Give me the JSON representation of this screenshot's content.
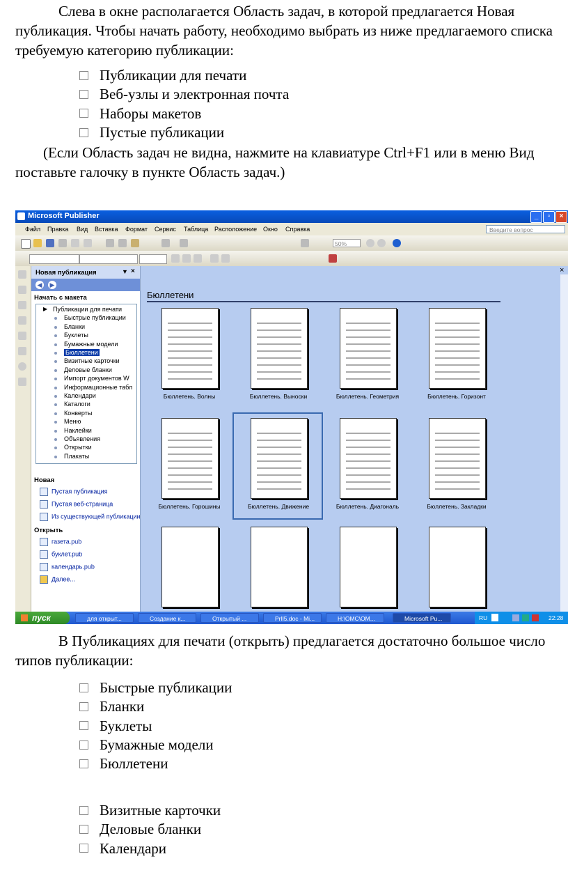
{
  "intro": {
    "paragraph": "Слева в окне располагается Область задач, в которой предлагается Новая публикация. Чтобы начать работу, необходимо выбрать из ниже предлагаемого списка требуемую категорию публикации:",
    "list": [
      "Публикации для печати",
      "Веб-узлы и электронная почта",
      "Наборы макетов",
      "Пустые публикации"
    ],
    "note": "(Если Область задач не видна, нажмите на клавиатуре Ctrl+F1 или в меню Вид поставьте галочку в пункте Область задач.)"
  },
  "screenshot": {
    "window_title": "Microsoft Publisher",
    "menu": [
      "Файл",
      "Правка",
      "Вид",
      "Вставка",
      "Формат",
      "Сервис",
      "Таблица",
      "Расположение",
      "Окно",
      "Справка"
    ],
    "help_placeholder": "Введите вопрос",
    "zoom": "50%",
    "task_pane": {
      "title": "Новая публикация",
      "start_section": "Начать с макета",
      "tree": [
        {
          "label": "Публикации для печати",
          "top": true
        },
        {
          "label": "Быстрые публикации"
        },
        {
          "label": "Бланки"
        },
        {
          "label": "Буклеты"
        },
        {
          "label": "Бумажные модели"
        },
        {
          "label": "Бюллетени",
          "selected": true
        },
        {
          "label": "Визитные карточки"
        },
        {
          "label": "Деловые бланки"
        },
        {
          "label": "Импорт документов W"
        },
        {
          "label": "Информационные табл"
        },
        {
          "label": "Календари"
        },
        {
          "label": "Каталоги"
        },
        {
          "label": "Конверты"
        },
        {
          "label": "Меню"
        },
        {
          "label": "Наклейки"
        },
        {
          "label": "Объявления"
        },
        {
          "label": "Открытки"
        },
        {
          "label": "Плакаты"
        }
      ],
      "new_section": "Новая",
      "new_items": [
        "Пустая публикация",
        "Пустая веб-страница",
        "Из существующей публикации..."
      ],
      "open_section": "Открыть",
      "open_items": [
        "газета.pub",
        "буклет.pub",
        "календарь.pub",
        "Далее..."
      ]
    },
    "gallery": {
      "heading": "Бюллетени",
      "captions": [
        "Бюллетень. Волны",
        "Бюллетень. Выноски",
        "Бюллетень. Геометрия",
        "Бюллетень. Горизонт",
        "Бюллетень. Горошины",
        "Бюллетень. Движение",
        "Бюллетень. Диагональ",
        "Бюллетень. Закладки"
      ]
    },
    "taskbar": {
      "start": "пуск",
      "tasks": [
        "для открыт...",
        "Создание к...",
        "Открытый ...",
        "PrIl5.doc - Mi...",
        "H:\\ОМС\\ОМ...",
        "Microsoft Pu..."
      ],
      "lang": "RU",
      "clock": "22:28"
    }
  },
  "section2": {
    "paragraph": "В Публикациях для печати (открыть) предлагается достаточно большое число типов публикации:",
    "list1": [
      "Быстрые публикации",
      "Бланки",
      "Буклеты",
      "Бумажные модели",
      "Бюллетени"
    ],
    "list2": [
      "Визитные карточки",
      "Деловые бланки",
      "Календари"
    ]
  },
  "colors": {
    "titlebar": "#0a5fe0",
    "pane_header": "#cfdcf5",
    "main_bg": "#b7ccf0",
    "selection": "#0a3ba8"
  }
}
